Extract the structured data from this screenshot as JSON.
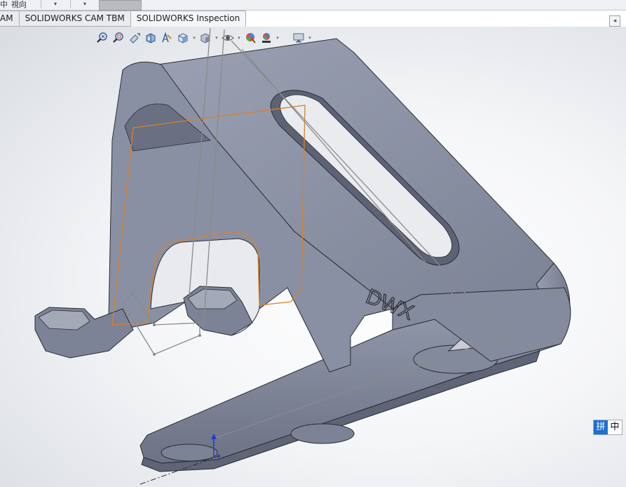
{
  "top_strip": {
    "fragment_left": "中",
    "fragment_text": "視向",
    "combo1": "▾",
    "combo2": "▾"
  },
  "tabs": [
    {
      "label": "AM",
      "active": false
    },
    {
      "label": "SOLIDWORKS CAM TBM",
      "active": false
    },
    {
      "label": "SOLIDWORKS Inspection",
      "active": true
    }
  ],
  "view_toolbar": [
    {
      "icon": "zoom-to-fit-icon"
    },
    {
      "icon": "zoom-to-area-icon"
    },
    {
      "icon": "previous-view-icon"
    },
    {
      "icon": "section-view-icon"
    },
    {
      "icon": "dynamic-annotation-icon"
    },
    {
      "icon": "view-orientation-icon",
      "dropdown": true
    },
    {
      "icon": "display-style-icon",
      "dropdown": true
    },
    {
      "icon": "hide-show-items-icon",
      "dropdown": true
    },
    {
      "icon": "edit-appearance-icon"
    },
    {
      "icon": "apply-scene-icon",
      "dropdown": true
    },
    {
      "icon": "view-settings-icon",
      "dropdown": true
    }
  ],
  "model": {
    "engraving": "DWX",
    "colors": {
      "body": "#8d93a6",
      "body_light": "#a8adbd",
      "body_dark": "#6e7386",
      "edge": "#2a2c33",
      "sketch": "#d9802a",
      "helper_line": "#8a8a8a",
      "axis": "#1f3bd6"
    }
  },
  "ime": {
    "pinyin": "拼",
    "chinese": "中"
  }
}
